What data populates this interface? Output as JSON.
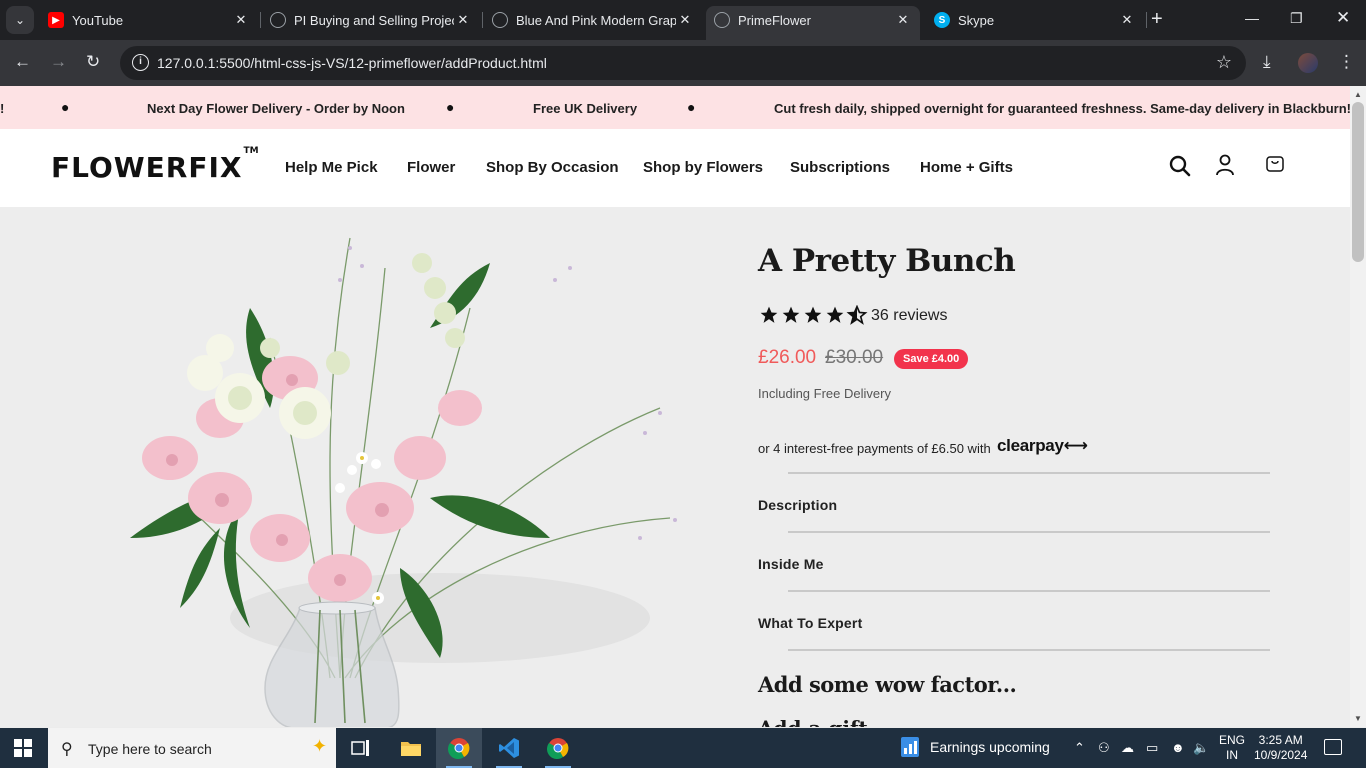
{
  "browser": {
    "tabs": [
      {
        "label": "YouTube",
        "icon": "youtube-icon",
        "color": "#ff0000"
      },
      {
        "label": "PI Buying and Selling Project",
        "icon": "globe-icon",
        "color": "#9aa0a6"
      },
      {
        "label": "Blue And Pink Modern Grap",
        "icon": "globe-icon",
        "color": "#9aa0a6"
      },
      {
        "label": "PrimeFlower",
        "icon": "globe-icon",
        "color": "#9aa0a6",
        "active": true
      },
      {
        "label": "Skype",
        "icon": "skype-icon",
        "color": "#00aff0"
      }
    ],
    "url": "127.0.0.1:5500/html-css-js-VS/12-primeflower/addProduct.html"
  },
  "announcement": {
    "items": [
      "!",
      "Next Day Flower Delivery - Order by Noon",
      "Free UK Delivery",
      "Cut fresh daily, shipped overnight for guaranteed freshness. Same-day delivery in Blackburn!"
    ]
  },
  "header": {
    "logo": "FLOWERFIX",
    "logo_tm": "TM",
    "nav": [
      "Help Me Pick",
      "Flower",
      "Shop By Occasion",
      "Shop by Flowers",
      "Subscriptions",
      "Home + Gifts"
    ]
  },
  "product": {
    "title": "A Pretty Bunch",
    "rating": 4.5,
    "reviews": "36 reviews",
    "price": "£26.00",
    "old_price": "£30.00",
    "save": "Save £4.00",
    "delivery": "Including Free Delivery",
    "clearpay_text": "or 4 interest-free payments of £6.50 with",
    "clearpay_logo": "clearpay",
    "accordion": [
      "Description",
      "Inside Me",
      "What To Expert"
    ],
    "wow": "Add some wow factor...",
    "add_gift": "Add a gift"
  },
  "taskbar": {
    "search_placeholder": "Type here to search",
    "weather": "Earnings upcoming",
    "lang_1": "ENG",
    "lang_2": "IN",
    "time": "3:25 AM",
    "date": "10/9/2024"
  },
  "colors": {
    "announce_bg": "#fde2e4",
    "price": "#f05a5a",
    "badge": "#f2334c"
  }
}
